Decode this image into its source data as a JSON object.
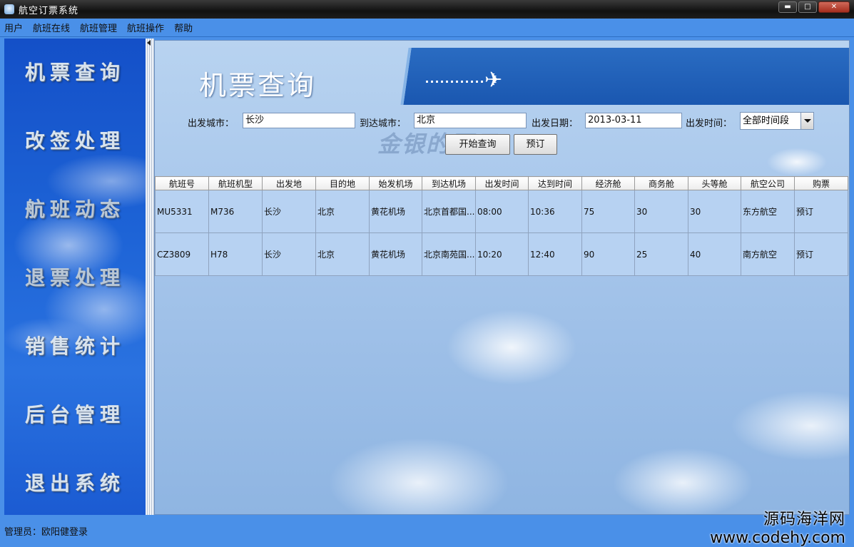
{
  "window": {
    "title": "航空订票系统",
    "min_label": "▬",
    "max_label": "□",
    "close_label": "✕"
  },
  "menu": [
    "用户",
    "航班在线",
    "航班管理",
    "航班操作",
    "帮助"
  ],
  "nav": [
    "机票查询",
    "改签处理",
    "航班动态",
    "退票处理",
    "销售统计",
    "后台管理",
    "退出系统"
  ],
  "main": {
    "page_title": "机票查询",
    "watermark": "金银的豆子",
    "search": {
      "from_label": "出发城市：",
      "from_value": "长沙",
      "to_label": "到达城市：",
      "to_value": "北京",
      "date_label": "出发日期：",
      "date_value": "2013-03-11",
      "time_label": "出发时间：",
      "time_value": "全部时间段"
    },
    "buttons": {
      "search": "开始查询",
      "book": "预订"
    }
  },
  "table": {
    "headers": [
      "航班号",
      "航班机型",
      "出发地",
      "目的地",
      "始发机场",
      "到达机场",
      "出发时间",
      "达到时间",
      "经济舱",
      "商务舱",
      "头等舱",
      "航空公司",
      "购票"
    ],
    "rows": [
      [
        "MU5331",
        "M736",
        "长沙",
        "北京",
        "黄花机场",
        "北京首都国...",
        "08:00",
        "10:36",
        "75",
        "30",
        "30",
        "东方航空",
        "预订"
      ],
      [
        "CZ3809",
        "H78",
        "长沙",
        "北京",
        "黄花机场",
        "北京南苑国...",
        "10:20",
        "12:40",
        "90",
        "25",
        "40",
        "南方航空",
        "预订"
      ]
    ]
  },
  "status": {
    "text": "管理员：欧阳健登录"
  },
  "site_watermark": {
    "cn": "源码海洋网",
    "url": "www.codehy.com"
  }
}
